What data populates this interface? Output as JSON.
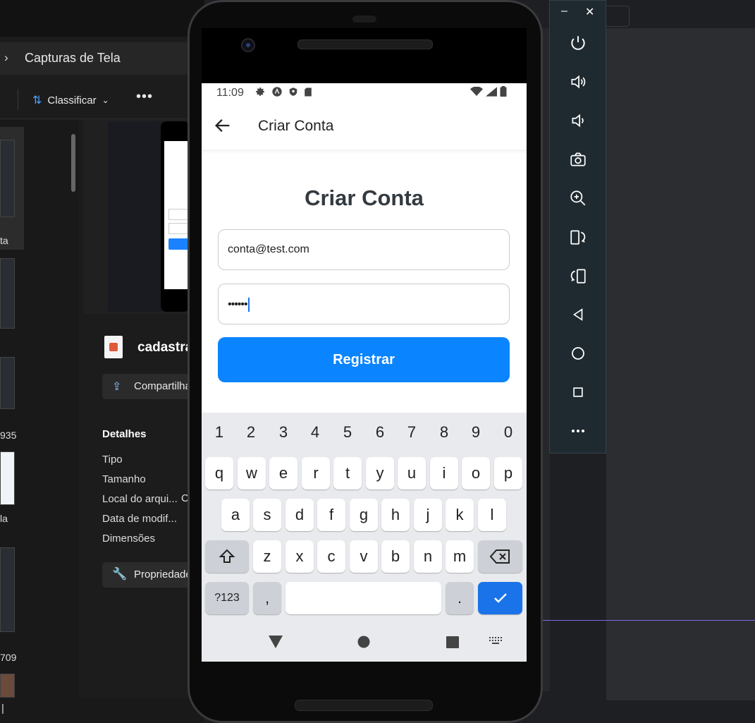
{
  "explorer": {
    "breadcrumb_chevron": "›",
    "breadcrumb": "Capturas de Tela",
    "sort_label": "Classificar",
    "sort_chevron": "⌄",
    "more": "•••",
    "thumb_labels": [
      "ta",
      "935",
      "la",
      "709"
    ],
    "file_name": "cadastra",
    "share_label": "Compartilha",
    "details_heading": "Detalhes",
    "details": [
      "Tipo",
      "Tamanho",
      "Local do arqui...",
      "Data de modif...",
      "Dimensões"
    ],
    "details_value_partial": "C",
    "properties_label": "Propriedade",
    "status_text": "|"
  },
  "emulator_toolbar": {
    "minimize": "–",
    "close": "✕",
    "tools": [
      "power-icon",
      "volume-up-icon",
      "volume-down-icon",
      "camera-icon",
      "zoom-icon",
      "rotate-left-icon",
      "rotate-right-icon",
      "back-icon",
      "home-icon",
      "overview-icon",
      "more-icon"
    ]
  },
  "phone": {
    "status_time": "11:09",
    "appbar_title": "Criar Conta",
    "page_title": "Criar Conta",
    "email_value": "conta@test.com",
    "password_value": "••••••",
    "register_label": "Registrar",
    "keyboard": {
      "numbers": [
        "1",
        "2",
        "3",
        "4",
        "5",
        "6",
        "7",
        "8",
        "9",
        "0"
      ],
      "row1": [
        "q",
        "w",
        "e",
        "r",
        "t",
        "y",
        "u",
        "i",
        "o",
        "p"
      ],
      "row2": [
        "a",
        "s",
        "d",
        "f",
        "g",
        "h",
        "j",
        "k",
        "l"
      ],
      "row3": [
        "z",
        "x",
        "c",
        "v",
        "b",
        "n",
        "m"
      ],
      "symbols_key": "?123",
      "comma_key": ",",
      "period_key": ".",
      "shift_glyph": "⇧",
      "enter_glyph": "✓"
    }
  },
  "colors": {
    "accent": "#0a84ff",
    "keyboard_bg": "#e8eaed",
    "enter_key": "#1a73e8",
    "emulator_toolbar": "#1f2a30"
  }
}
